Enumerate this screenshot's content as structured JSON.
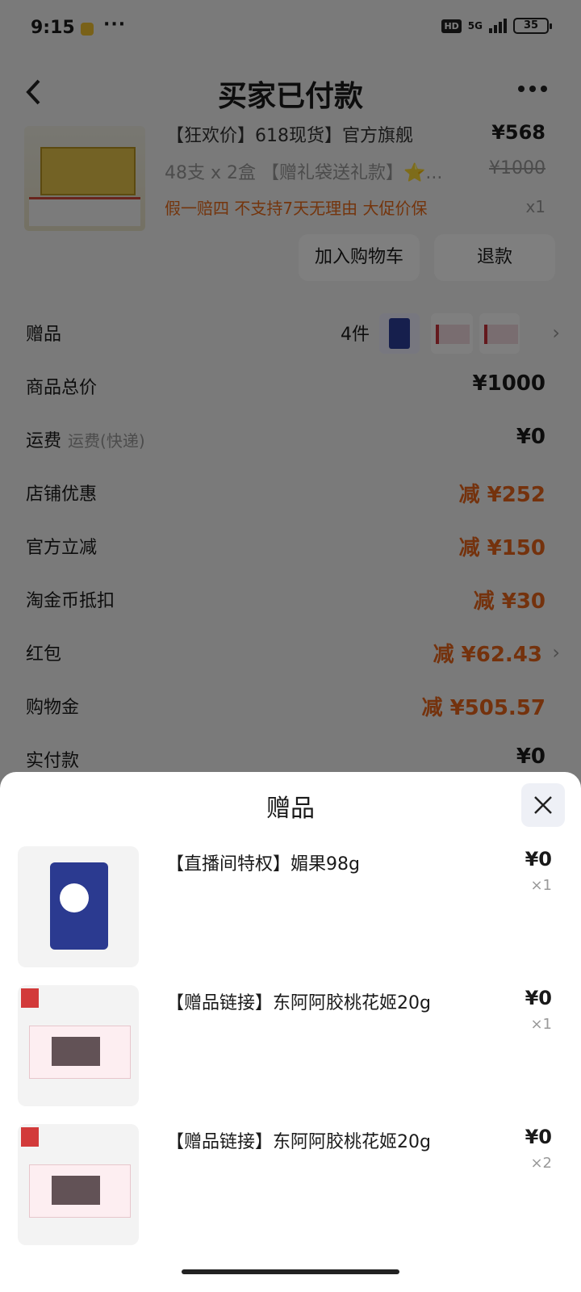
{
  "status_bar": {
    "time": "9:15",
    "dots": "···",
    "hd": "HD",
    "network": "5G",
    "battery": "35"
  },
  "header": {
    "title": "买家已付款"
  },
  "product": {
    "title": "【狂欢价】618现货】官方旗舰",
    "price": "¥568",
    "sku": "48支 x 2盒 【赠礼袋送礼款】⭐...",
    "original_price": "¥1000",
    "tags": "假一赔四  不支持7天无理由  大促价保",
    "quantity": "x1",
    "add_to_cart": "加入购物车",
    "refund": "退款"
  },
  "summary": {
    "gift": {
      "label": "赠品",
      "count": "4件"
    },
    "total": {
      "label": "商品总价",
      "value": "¥1000"
    },
    "shipping": {
      "label": "运费",
      "sub": "运费(快递)",
      "value": "¥0"
    },
    "store_discount": {
      "label": "店铺优惠",
      "value": "减 ¥252"
    },
    "official_discount": {
      "label": "官方立减",
      "value": "减 ¥150"
    },
    "coins": {
      "label": "淘金币抵扣",
      "value": "减 ¥30"
    },
    "red_packet": {
      "label": "红包",
      "value": "减 ¥62.43"
    },
    "shopping_gold": {
      "label": "购物金",
      "value": "减 ¥505.57"
    },
    "paid": {
      "label": "实付款",
      "value": "¥0"
    }
  },
  "gift_sheet": {
    "title": "赠品",
    "items": [
      {
        "name": "【直播间特权】媚果98g",
        "price": "¥0",
        "qty": "×1"
      },
      {
        "name": "【赠品链接】东阿阿胶桃花姬20g",
        "price": "¥0",
        "qty": "×1"
      },
      {
        "name": "【赠品链接】东阿阿胶桃花姬20g",
        "price": "¥0",
        "qty": "×2"
      }
    ]
  }
}
